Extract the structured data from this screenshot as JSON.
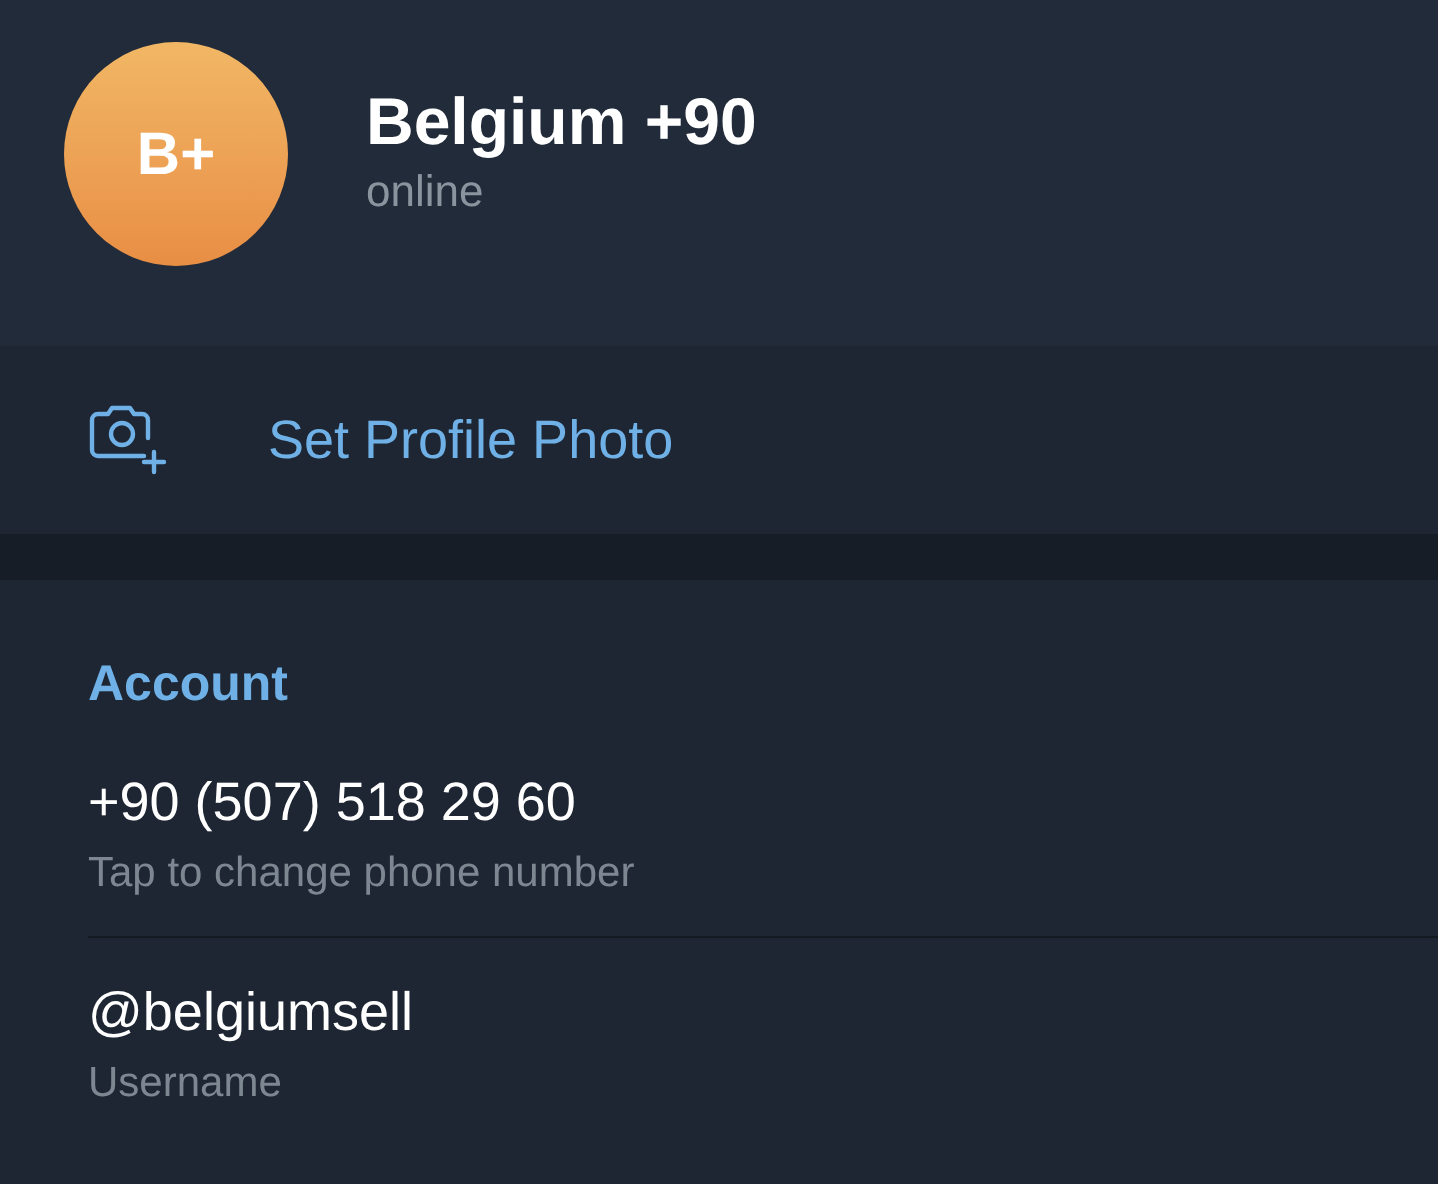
{
  "profile": {
    "avatar_initials": "B+",
    "name": "Belgium +90",
    "status": "online"
  },
  "set_photo": {
    "label": "Set Profile Photo"
  },
  "account": {
    "heading": "Account",
    "rows": [
      {
        "value": "+90 (507) 518 29 60",
        "caption": "Tap to change phone number"
      },
      {
        "value": "@belgiumsell",
        "caption": "Username"
      }
    ]
  }
}
